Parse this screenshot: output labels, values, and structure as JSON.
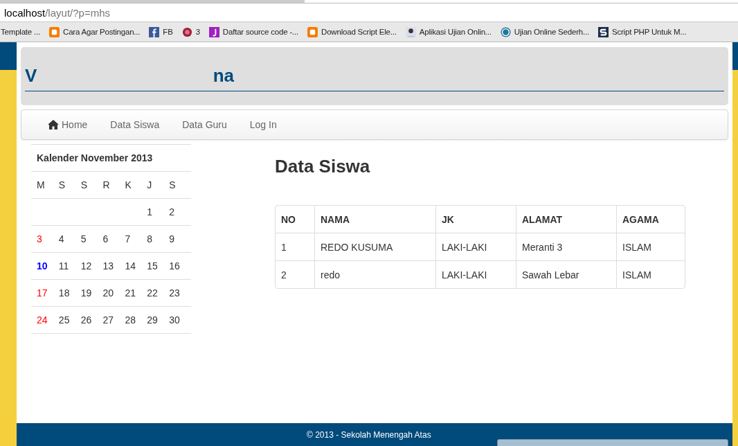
{
  "browser": {
    "url_host": "localhost",
    "url_path": "/layut/?p=mhs",
    "bookmarks": [
      {
        "label": "Template ...",
        "kind": "none"
      },
      {
        "label": "Cara Agar Postingan...",
        "kind": "blogger"
      },
      {
        "label": "FB",
        "kind": "facebook"
      },
      {
        "label": "3",
        "kind": "three"
      },
      {
        "label": "Daftar source code -...",
        "kind": "j"
      },
      {
        "label": "Download Script Ele...",
        "kind": "blogger"
      },
      {
        "label": "Aplikasi Ujian Onlin...",
        "kind": "person"
      },
      {
        "label": "Ujian Online Sederh...",
        "kind": "wordpress"
      },
      {
        "label": "Script PHP Untuk M...",
        "kind": "s"
      }
    ]
  },
  "header": {
    "title_start": "V",
    "title_end": "na"
  },
  "nav": [
    {
      "label": "Home",
      "kind": "home"
    },
    {
      "label": "Data Siswa",
      "kind": "plain"
    },
    {
      "label": "Data Guru",
      "kind": "plain"
    },
    {
      "label": "Log In",
      "kind": "plain"
    }
  ],
  "calendar": {
    "title": "Kalender November 2013",
    "weekdays": [
      "M",
      "S",
      "S",
      "R",
      "K",
      "J",
      "S"
    ],
    "weeks": [
      [
        {
          "kind": "blank"
        },
        {
          "kind": "blank"
        },
        {
          "kind": "blank"
        },
        {
          "kind": "blank"
        },
        {
          "kind": "blank"
        },
        {
          "text": "1",
          "kind": "plain"
        },
        {
          "text": "2",
          "kind": "plain"
        }
      ],
      [
        {
          "text": "3",
          "kind": "holiday"
        },
        {
          "text": "4",
          "kind": "plain"
        },
        {
          "text": "5",
          "kind": "plain"
        },
        {
          "text": "6",
          "kind": "plain"
        },
        {
          "text": "7",
          "kind": "plain"
        },
        {
          "text": "8",
          "kind": "plain"
        },
        {
          "text": "9",
          "kind": "plain"
        }
      ],
      [
        {
          "text": "10",
          "kind": "today"
        },
        {
          "text": "11",
          "kind": "plain"
        },
        {
          "text": "12",
          "kind": "plain"
        },
        {
          "text": "13",
          "kind": "plain"
        },
        {
          "text": "14",
          "kind": "plain"
        },
        {
          "text": "15",
          "kind": "plain"
        },
        {
          "text": "16",
          "kind": "plain"
        }
      ],
      [
        {
          "text": "17",
          "kind": "holiday"
        },
        {
          "text": "18",
          "kind": "plain"
        },
        {
          "text": "19",
          "kind": "plain"
        },
        {
          "text": "20",
          "kind": "plain"
        },
        {
          "text": "21",
          "kind": "plain"
        },
        {
          "text": "22",
          "kind": "plain"
        },
        {
          "text": "23",
          "kind": "plain"
        }
      ],
      [
        {
          "text": "24",
          "kind": "holiday"
        },
        {
          "text": "25",
          "kind": "plain"
        },
        {
          "text": "26",
          "kind": "plain"
        },
        {
          "text": "27",
          "kind": "plain"
        },
        {
          "text": "28",
          "kind": "plain"
        },
        {
          "text": "29",
          "kind": "plain"
        },
        {
          "text": "30",
          "kind": "plain"
        }
      ]
    ]
  },
  "main": {
    "heading": "Data Siswa",
    "table": {
      "columns": [
        "NO",
        "NAMA",
        "JK",
        "ALAMAT",
        "AGAMA"
      ],
      "rows": [
        [
          "1",
          "REDO KUSUMA",
          "LAKI-LAKI",
          "Meranti 3",
          "ISLAM"
        ],
        [
          "2",
          "redo",
          "LAKI-LAKI",
          "Sawah Lebar",
          "ISLAM"
        ]
      ]
    }
  },
  "footer": {
    "text": "© 2013 - Sekolah Menengah Atas"
  }
}
